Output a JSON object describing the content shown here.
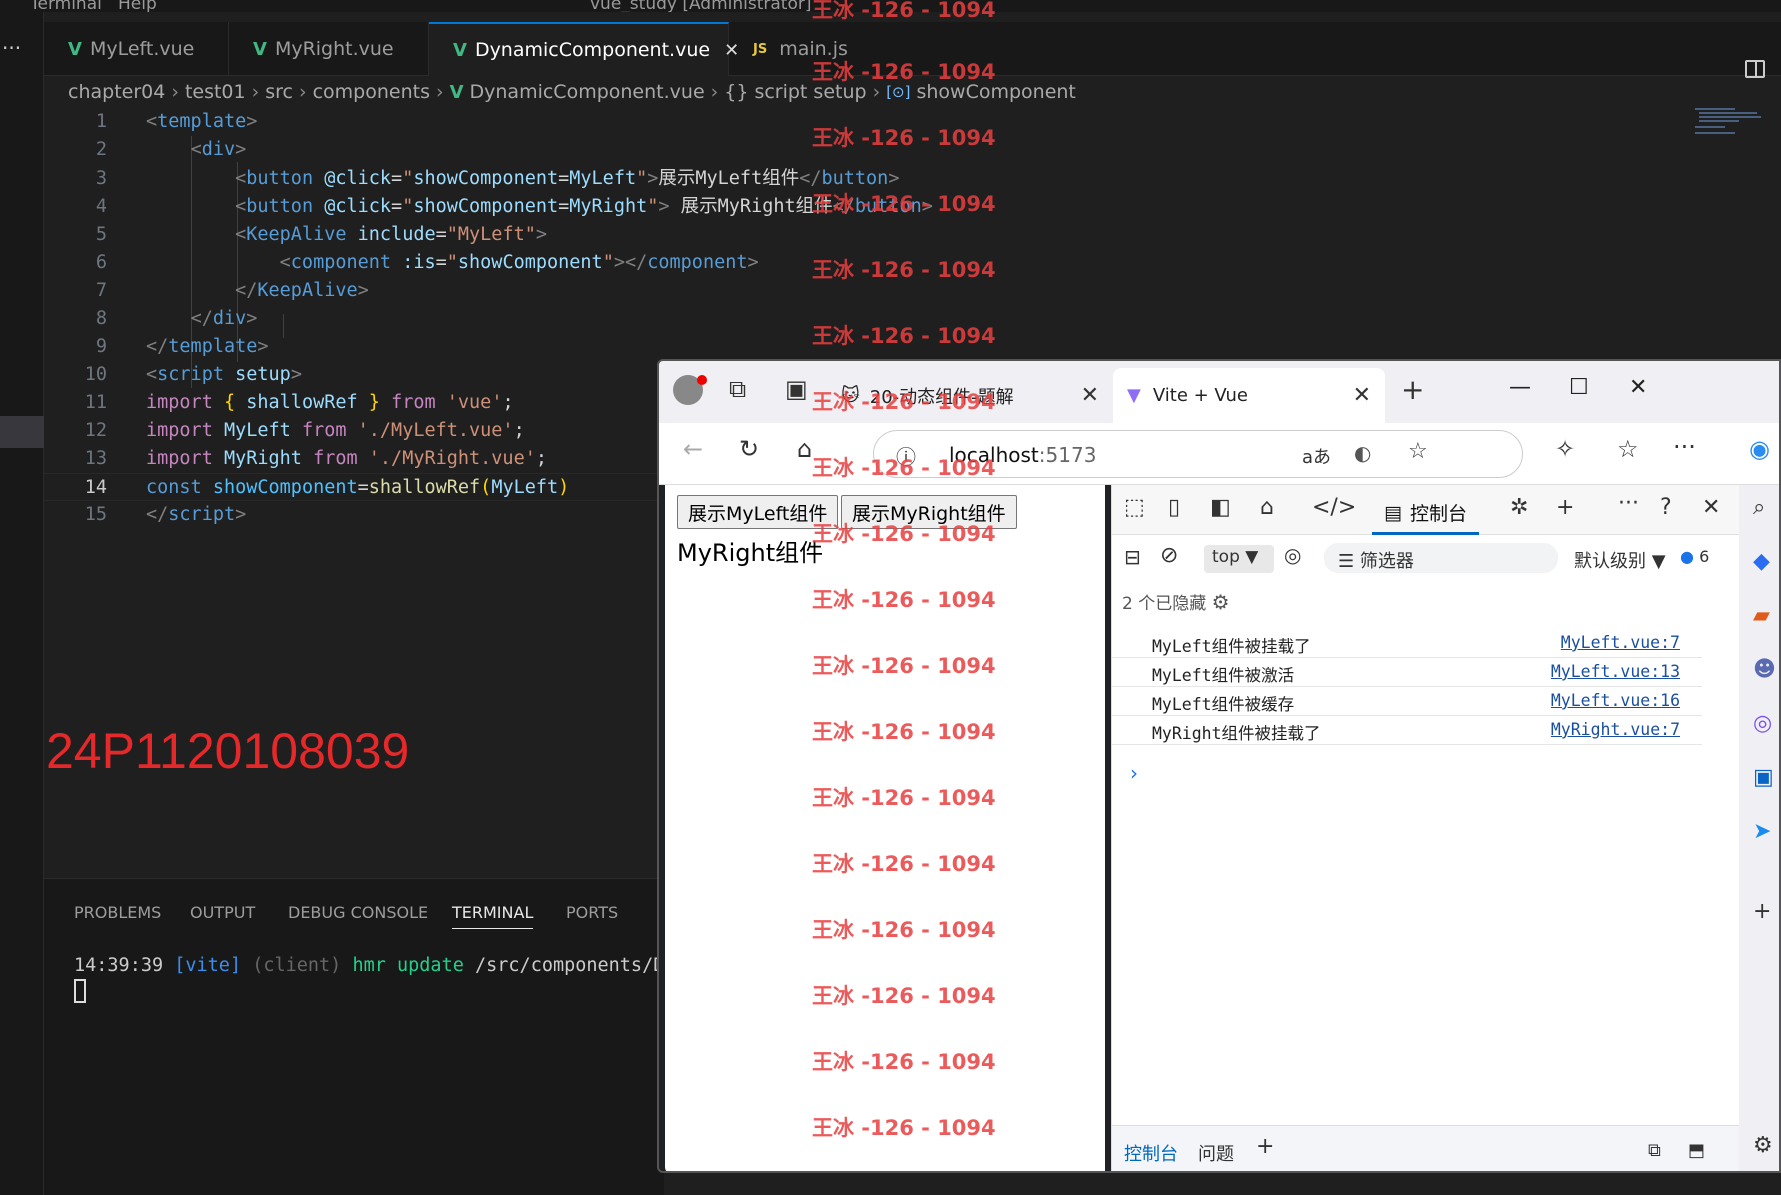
{
  "titlebar": {
    "menu": [
      "Terminal",
      "Help"
    ],
    "title": "vue_study [Administrator]"
  },
  "tabs": [
    {
      "label": "MyLeft.vue",
      "icon": "vue-icon"
    },
    {
      "label": "MyRight.vue",
      "icon": "vue-icon"
    },
    {
      "label": "DynamicComponent.vue",
      "icon": "vue-icon",
      "active": true,
      "close": "✕"
    },
    {
      "label": "main.js",
      "icon": "js-icon",
      "badge": "JS"
    }
  ],
  "breadcrumb": [
    "chapter04",
    "test01",
    "src",
    "components",
    "DynamicComponent.vue",
    "script setup",
    "showComponent"
  ],
  "breadcrumb_icons": {
    "script": "{}",
    "symbol": "[⊙]"
  },
  "editor": {
    "current_line": 14,
    "lines": [
      {
        "n": "1"
      },
      {
        "n": "2"
      },
      {
        "n": "3"
      },
      {
        "n": "4"
      },
      {
        "n": "5"
      },
      {
        "n": "6"
      },
      {
        "n": "7"
      },
      {
        "n": "8"
      },
      {
        "n": "9"
      },
      {
        "n": "10"
      },
      {
        "n": "11"
      },
      {
        "n": "12"
      },
      {
        "n": "13"
      },
      {
        "n": "14"
      },
      {
        "n": "15"
      }
    ]
  },
  "student_id": "24P1120108039",
  "panel": {
    "tabs": [
      "PROBLEMS",
      "OUTPUT",
      "DEBUG CONSOLE",
      "TERMINAL",
      "PORTS"
    ],
    "active": "TERMINAL",
    "terminal": {
      "time": "14:39:39",
      "tag": "[vite]",
      "client": "(client)",
      "hmr": "hmr update",
      "path": "/src/components/D"
    }
  },
  "browser": {
    "tabs": [
      {
        "label": "20-动态组件-题解"
      },
      {
        "label": "Vite + Vue",
        "active": true
      }
    ],
    "url_host": "localhost",
    "url_port": ":5173",
    "page": {
      "buttons": [
        "展示MyLeft组件",
        "展示MyRight组件"
      ],
      "message": "MyRight组件"
    },
    "devtools": {
      "active_tab": "控制台",
      "context": "top",
      "filter_placeholder": "筛选器",
      "level": "默认级别",
      "message_count": "6",
      "hidden": "2 个已隐藏",
      "logs": [
        {
          "msg": "MyLeft组件被挂载了",
          "src": "MyLeft.vue:7"
        },
        {
          "msg": "MyLeft组件被激活",
          "src": "MyLeft.vue:13"
        },
        {
          "msg": "MyLeft组件被缓存",
          "src": "MyLeft.vue:16"
        },
        {
          "msg": "MyRight组件被挂载了",
          "src": "MyRight.vue:7"
        }
      ],
      "footer_tabs": [
        "控制台",
        "问题"
      ]
    }
  },
  "watermark": "王冰 -126 - 1094",
  "colors": {
    "accent": "#0078d4",
    "vue": "#41b883",
    "watermark": "#e83f3f",
    "student_id": "#e5282a"
  }
}
